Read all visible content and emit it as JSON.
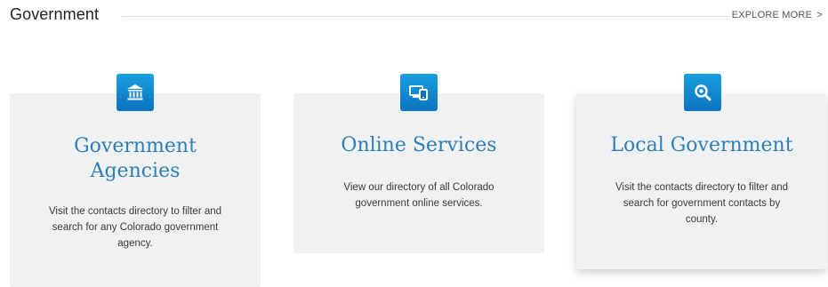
{
  "header": {
    "title": "Government",
    "explore_label": "EXPLORE MORE",
    "explore_chevron": ">"
  },
  "cards": [
    {
      "icon": "bank-building-icon",
      "title": "Government Agencies",
      "description": "Visit the contacts directory to filter and search for any Colorado government agency."
    },
    {
      "icon": "devices-icon",
      "title": "Online Services",
      "description": "View our directory of all Colorado government online services."
    },
    {
      "icon": "search-magnifier-icon",
      "title": "Local Government",
      "description": "Visit the contacts directory to filter and search for government contacts by county."
    }
  ],
  "colors": {
    "accent": "#0a73bf",
    "accent_light": "#1a9fe0",
    "card_title": "#2f7fb7",
    "card_background": "#f0f1f3"
  }
}
